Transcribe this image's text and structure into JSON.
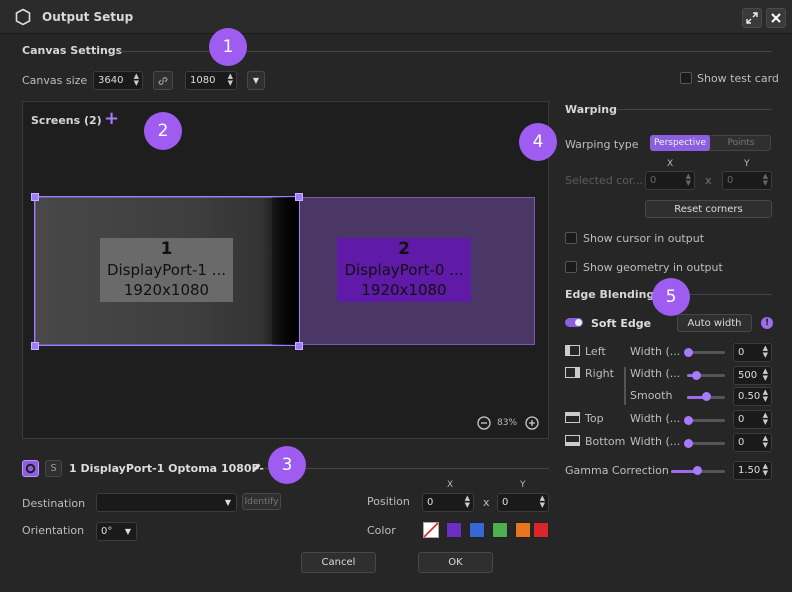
{
  "window": {
    "title": "Output Setup"
  },
  "canvas": {
    "section_title": "Canvas Settings",
    "size_label": "Canvas size",
    "width": "3640",
    "height": "1080",
    "show_test_card": "Show test card"
  },
  "screens": {
    "title": "Screens (2)",
    "zoom": "83%",
    "items": [
      {
        "number": "1",
        "name": "DisplayPort-1 ...",
        "resolution": "1920x1080"
      },
      {
        "number": "2",
        "name": "DisplayPort-0 ...",
        "resolution": "1920x1080"
      }
    ]
  },
  "selected_screen": {
    "title": "1 DisplayPort-1 Optoma 1080P-",
    "o_label": "O",
    "s_label": "S",
    "destination_label": "Destination",
    "destination_value": "",
    "identify_label": "Identify",
    "orientation_label": "Orientation",
    "orientation_value": "0°",
    "position_label": "Position",
    "pos_x_header": "X",
    "pos_y_header": "Y",
    "pos_x": "0",
    "pos_y": "0",
    "pos_separator": "x",
    "color_label": "Color",
    "colors": [
      "#6a2fc2",
      "#3568d4",
      "#4caf50",
      "#e8741e",
      "#d9262a"
    ]
  },
  "warping": {
    "title": "Warping",
    "type_label": "Warping type",
    "tab_perspective": "Perspective",
    "tab_points": "Points",
    "x_header": "X",
    "y_header": "Y",
    "selected_corner_label": "Selected cor...",
    "x_value": "0",
    "y_value": "0",
    "separator": "x",
    "reset_label": "Reset corners",
    "show_cursor": "Show cursor in output",
    "show_geometry": "Show geometry in output"
  },
  "edge_blending": {
    "title": "Edge Blending",
    "soft_edge_label": "Soft Edge",
    "auto_width_label": "Auto width",
    "left_label": "Left",
    "right_label": "Right",
    "top_label": "Top",
    "bottom_label": "Bottom",
    "width_label": "Width (...",
    "smooth_label": "Smooth",
    "left_width": "0",
    "right_width": "500",
    "right_smooth": "0.50",
    "top_width": "0",
    "bottom_width": "0",
    "gamma_label": "Gamma Correction",
    "gamma_value": "1.50"
  },
  "footer": {
    "cancel_label": "Cancel",
    "ok_label": "OK"
  },
  "badges": [
    "1",
    "2",
    "3",
    "4",
    "5"
  ],
  "accent_color": "#9f5cf0"
}
